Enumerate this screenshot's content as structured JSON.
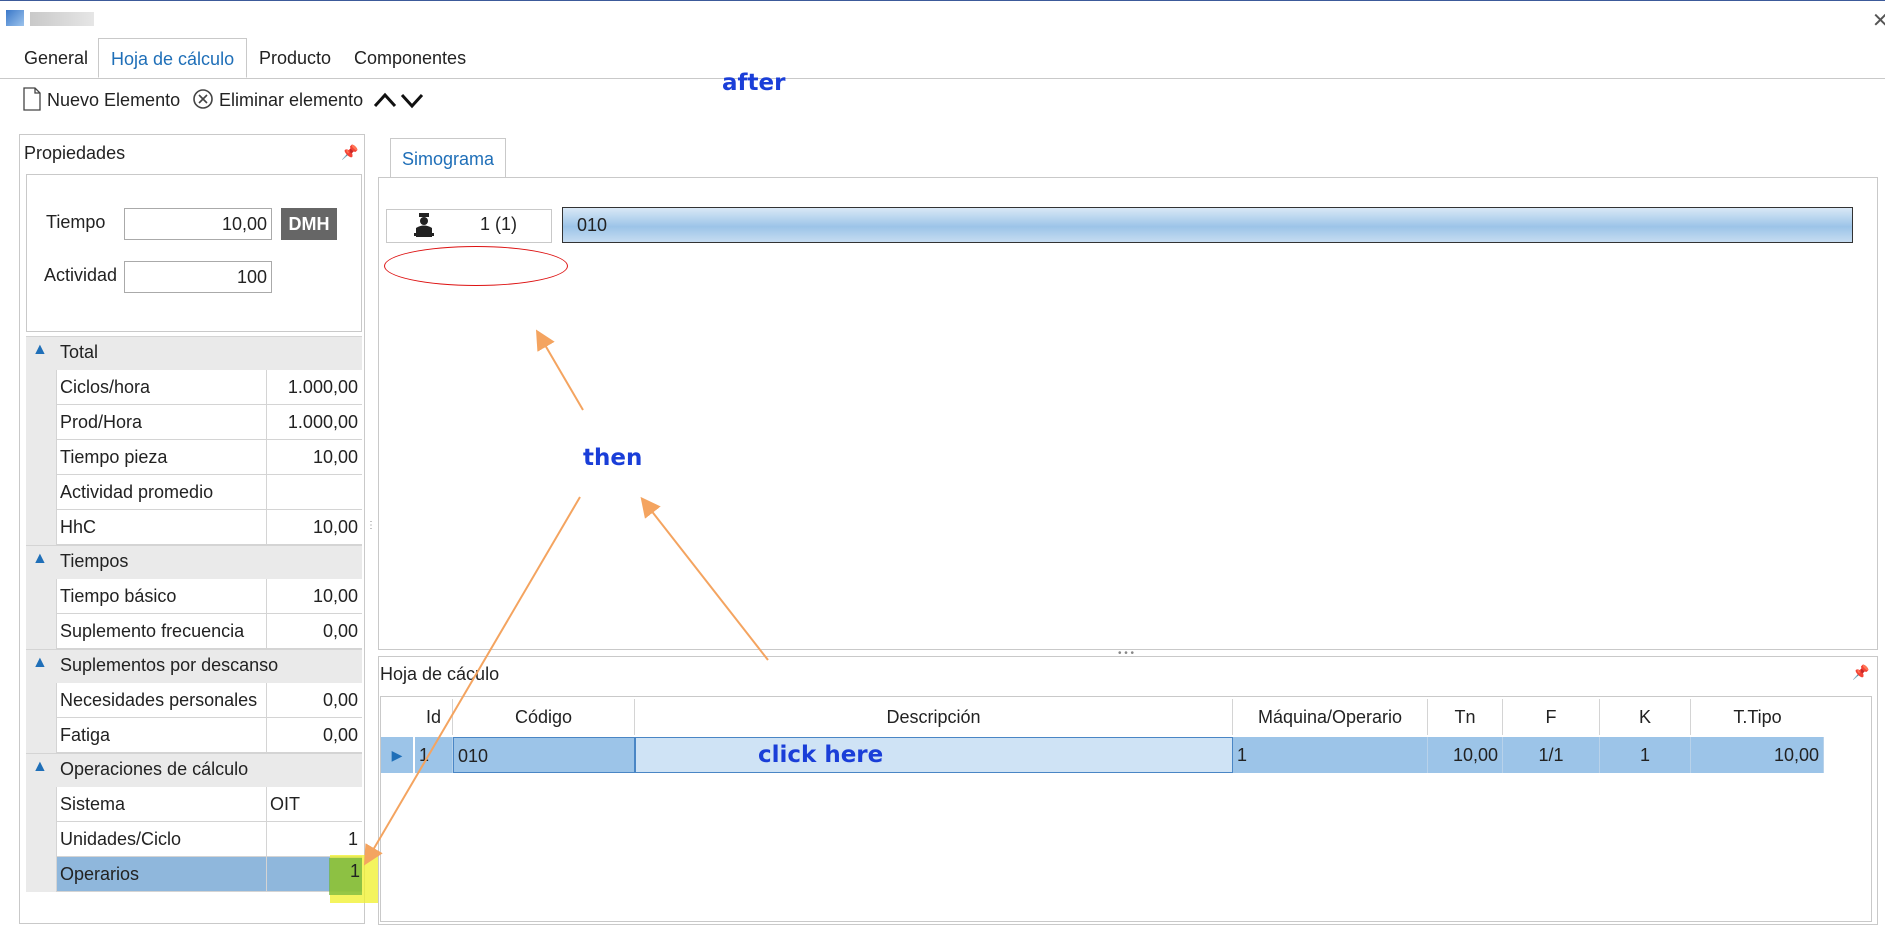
{
  "window": {
    "close_icon": "close-icon"
  },
  "tabs": [
    {
      "label": "General"
    },
    {
      "label": "Hoja de cálculo"
    },
    {
      "label": "Producto"
    },
    {
      "label": "Componentes"
    }
  ],
  "toolbar": {
    "new_label": "Nuevo Elemento",
    "delete_label": "Eliminar elemento"
  },
  "annotations": {
    "after": "after",
    "then": "then",
    "click_here": "click here"
  },
  "properties": {
    "header": "Propiedades",
    "tiempo_label": "Tiempo",
    "tiempo_value": "10,00",
    "unit_button": "DMH",
    "actividad_label": "Actividad",
    "actividad_value": "100",
    "categories": [
      {
        "label": "Total",
        "rows": [
          {
            "name": "Ciclos/hora",
            "value": "1.000,00"
          },
          {
            "name": "Prod/Hora",
            "value": "1.000,00"
          },
          {
            "name": "Tiempo pieza",
            "value": "10,00"
          },
          {
            "name": "Actividad promedio",
            "value": ""
          },
          {
            "name": "HhC",
            "value": "10,00"
          }
        ]
      },
      {
        "label": "Tiempos",
        "rows": [
          {
            "name": "Tiempo básico",
            "value": "10,00"
          },
          {
            "name": "Suplemento frecuencia",
            "value": "0,00"
          }
        ]
      },
      {
        "label": "Suplementos por descanso",
        "rows": [
          {
            "name": "Necesidades personales",
            "value": "0,00"
          },
          {
            "name": "Fatiga",
            "value": "0,00"
          }
        ]
      },
      {
        "label": "Operaciones de cálculo",
        "rows": [
          {
            "name": "Sistema",
            "value": "OIT"
          },
          {
            "name": "Unidades/Ciclo",
            "value": "1"
          },
          {
            "name": "Operarios",
            "value": "1"
          }
        ]
      }
    ]
  },
  "simograma": {
    "tab_label": "Simograma",
    "worker_count": "1 (1)",
    "operation_code": "010"
  },
  "hoja": {
    "title": "Hoja de cáculo",
    "columns": [
      "Id",
      "Código",
      "Descripción",
      "Máquina/Operario",
      "Tn",
      "F",
      "K",
      "T.Tipo"
    ],
    "rows": [
      {
        "id": "1",
        "codigo": "010",
        "descripcion": "",
        "maquina": "1",
        "tn": "10,00",
        "f": "1/1",
        "k": "1",
        "ttipo": "10,00"
      }
    ]
  }
}
